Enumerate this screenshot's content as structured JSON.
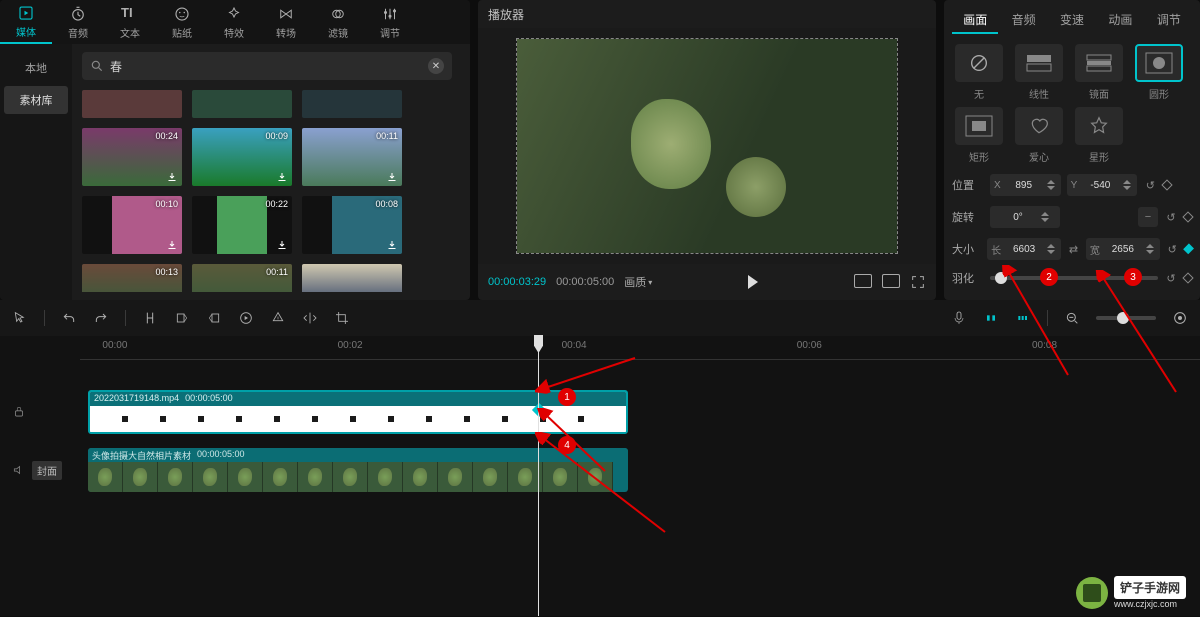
{
  "top_tabs": [
    {
      "label": "媒体",
      "icon": "play-box"
    },
    {
      "label": "音频",
      "icon": "timer"
    },
    {
      "label": "文本",
      "icon": "TI"
    },
    {
      "label": "贴纸",
      "icon": "smiley"
    },
    {
      "label": "特效",
      "icon": "sparkle"
    },
    {
      "label": "转场",
      "icon": "bowtie"
    },
    {
      "label": "滤镜",
      "icon": "venn"
    },
    {
      "label": "调节",
      "icon": "sliders"
    }
  ],
  "sidebar": {
    "items": [
      "本地",
      "素材库"
    ],
    "active": 1
  },
  "search": {
    "value": "春",
    "icon": "search-icon"
  },
  "thumbs": [
    {
      "dur": "00:24"
    },
    {
      "dur": "00:09"
    },
    {
      "dur": "00:11"
    },
    {
      "dur": "00:10"
    },
    {
      "dur": "00:22"
    },
    {
      "dur": "00:08"
    },
    {
      "dur": "00:13"
    },
    {
      "dur": "00:11"
    }
  ],
  "player": {
    "title": "播放器",
    "current": "00:00:03:29",
    "total": "00:00:05:00",
    "ratio": "画质"
  },
  "inspector": {
    "tabs": [
      "画面",
      "音频",
      "变速",
      "动画",
      "调节"
    ],
    "active": 0,
    "shapes": [
      {
        "label": "无",
        "icon": "none"
      },
      {
        "label": "线性",
        "icon": "linear"
      },
      {
        "label": "镜面",
        "icon": "mirror"
      },
      {
        "label": "圆形",
        "icon": "circle",
        "selected": true
      },
      {
        "label": "矩形",
        "icon": "rect"
      },
      {
        "label": "爱心",
        "icon": "heart"
      },
      {
        "label": "星形",
        "icon": "star"
      }
    ],
    "pos": {
      "label": "位置",
      "x_label": "X",
      "y_label": "Y",
      "x": "895",
      "y": "-540"
    },
    "rot": {
      "label": "旋转",
      "value": "0°"
    },
    "size": {
      "label": "大小",
      "w_label": "长",
      "h_label": "宽",
      "w": "6603",
      "h": "2656"
    },
    "feather": {
      "label": "羽化"
    }
  },
  "timeline": {
    "ticks": [
      "00:00",
      "00:02",
      "00:04",
      "00:06",
      "00:08"
    ],
    "clip1": {
      "name": "2022031719148.mp4",
      "dur": "00:00:05:00"
    },
    "clip2": {
      "name": "头像拍摄大自然相片素材",
      "dur": "00:00:05:00"
    },
    "cover": "封面"
  },
  "watermark": {
    "name": "铲子手游网",
    "url": "www.czjxjc.com"
  }
}
